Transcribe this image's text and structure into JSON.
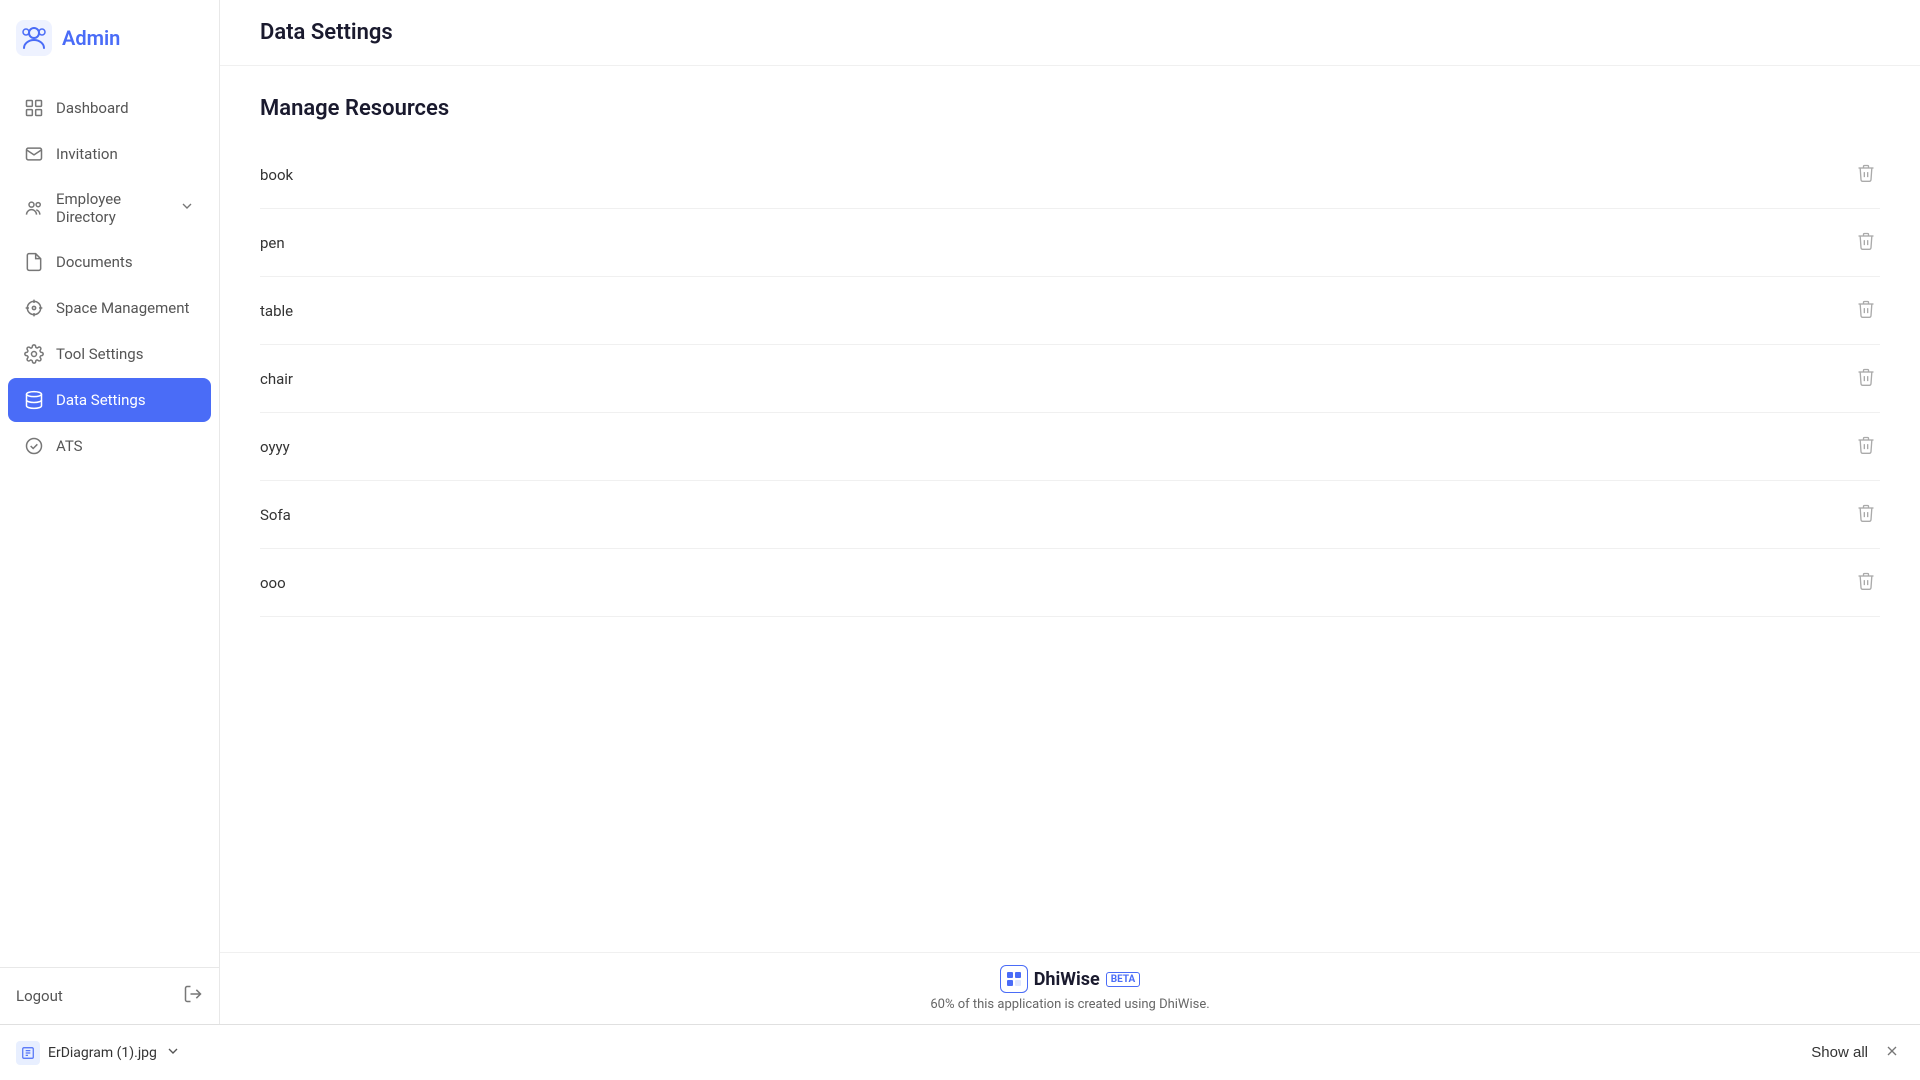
{
  "sidebar": {
    "brand": {
      "title": "Admin",
      "icon_label": "admin-logo-icon"
    },
    "nav_items": [
      {
        "id": "dashboard",
        "label": "Dashboard",
        "icon": "dashboard-icon",
        "active": false
      },
      {
        "id": "invitation",
        "label": "Invitation",
        "icon": "invitation-icon",
        "active": false
      },
      {
        "id": "employee-directory",
        "label": "Employee Directory",
        "icon": "employee-directory-icon",
        "active": false,
        "has_chevron": true
      },
      {
        "id": "documents",
        "label": "Documents",
        "icon": "documents-icon",
        "active": false
      },
      {
        "id": "space-management",
        "label": "Space Management",
        "icon": "space-management-icon",
        "active": false
      },
      {
        "id": "tool-settings",
        "label": "Tool Settings",
        "icon": "tool-settings-icon",
        "active": false
      },
      {
        "id": "data-settings",
        "label": "Data Settings",
        "icon": "data-settings-icon",
        "active": true
      },
      {
        "id": "ats",
        "label": "ATS",
        "icon": "ats-icon",
        "active": false
      }
    ],
    "logout": {
      "label": "Logout",
      "icon": "logout-icon"
    }
  },
  "header": {
    "page_title": "Data Settings"
  },
  "main": {
    "section_title": "Manage Resources",
    "resources": [
      {
        "id": 1,
        "name": "book"
      },
      {
        "id": 2,
        "name": "pen"
      },
      {
        "id": 3,
        "name": "table"
      },
      {
        "id": 4,
        "name": "chair"
      },
      {
        "id": 5,
        "name": "oyyy"
      },
      {
        "id": 6,
        "name": "Sofa"
      },
      {
        "id": 7,
        "name": "ooo"
      }
    ]
  },
  "footer": {
    "brand": "DhiWise",
    "badge": "BETA",
    "subtitle": "60% of this application is created using DhiWise."
  },
  "bottom_bar": {
    "file_name": "ErDiagram (1).jpg",
    "show_all_label": "Show all"
  }
}
